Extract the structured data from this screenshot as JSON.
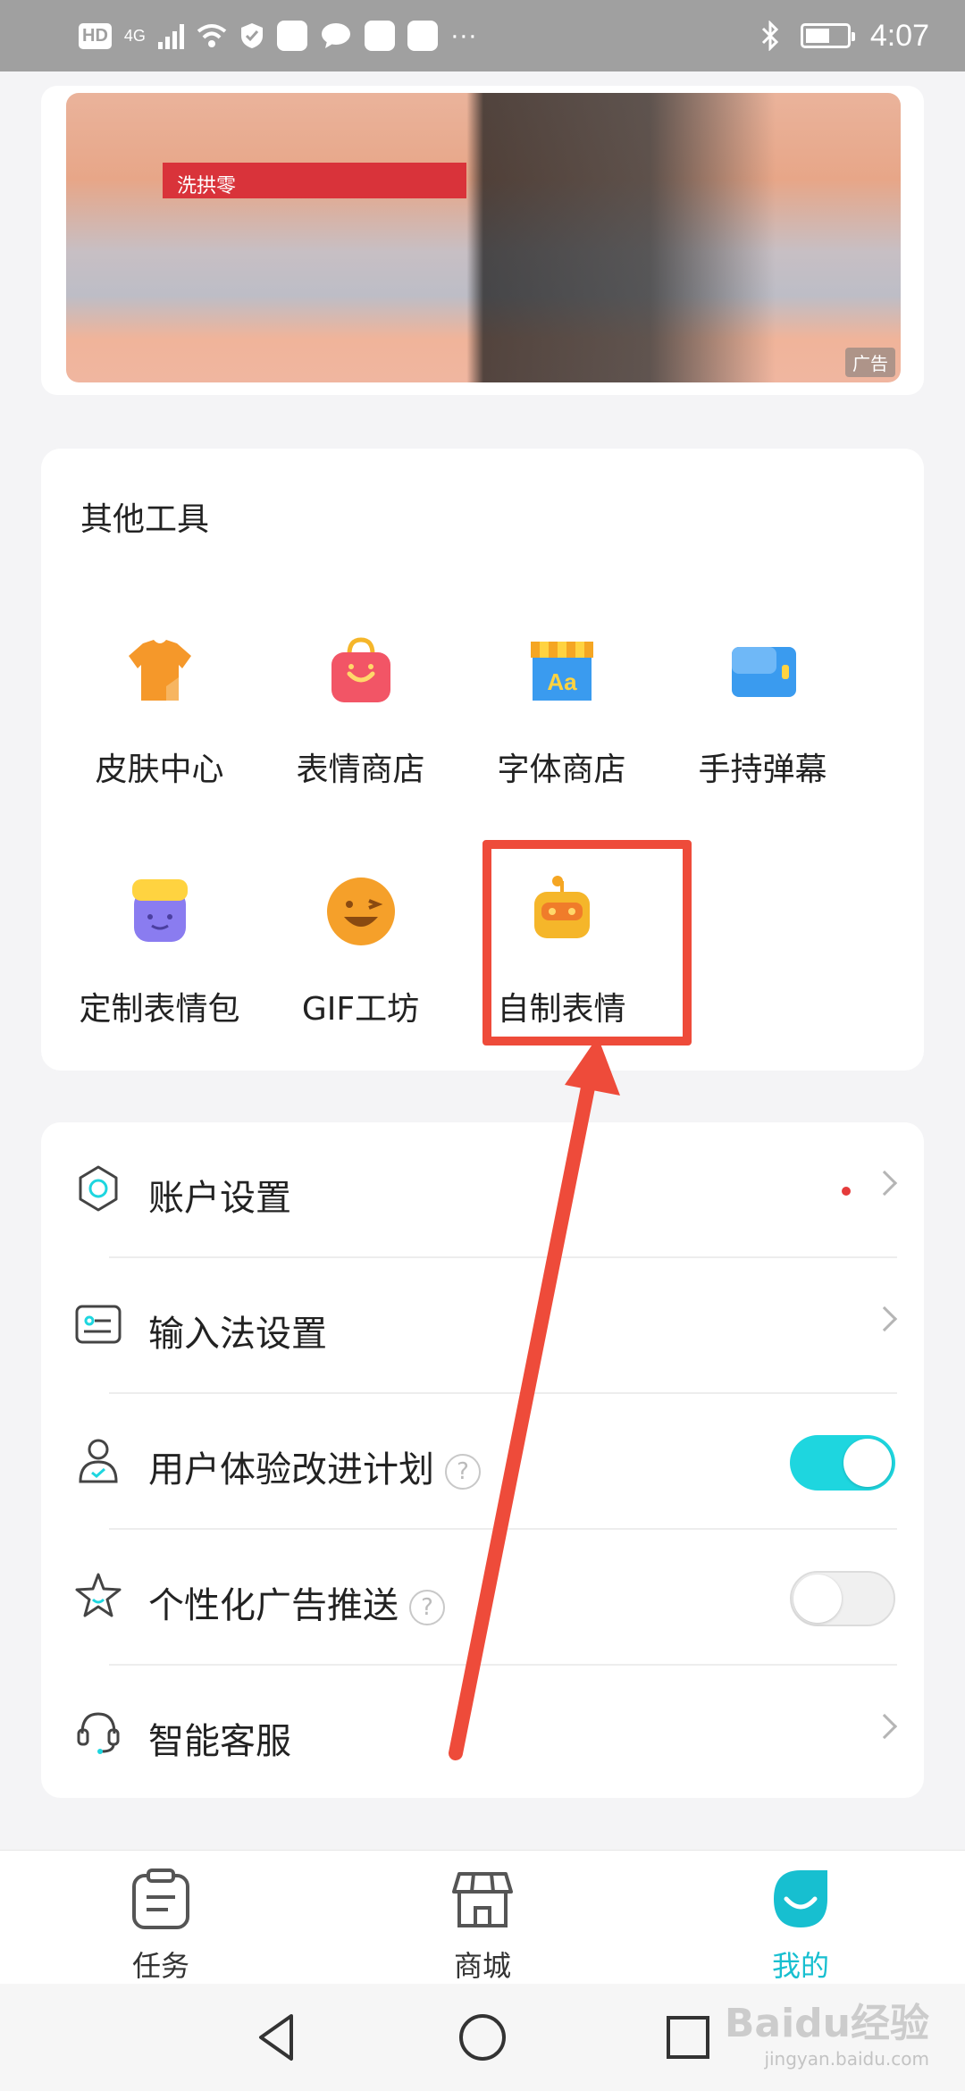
{
  "status_bar": {
    "network": "HD",
    "signal": "4G",
    "time": "4:07",
    "more": "···"
  },
  "ad": {
    "blurred_text": "洗拱零",
    "tag": "广告"
  },
  "tools": {
    "title": "其他工具",
    "items": [
      {
        "label": "皮肤中心",
        "icon": "shirt-icon",
        "color": "#f5982a"
      },
      {
        "label": "表情商店",
        "icon": "shopping-bag-icon",
        "color": "#f25566"
      },
      {
        "label": "字体商店",
        "icon": "font-store-icon",
        "color": "#3a9bef"
      },
      {
        "label": "手持弹幕",
        "icon": "handheld-barrage-icon",
        "color": "#3a9bef"
      },
      {
        "label": "定制表情包",
        "icon": "custom-sticker-icon",
        "color": "#8a7cf0"
      },
      {
        "label": "GIF工坊",
        "icon": "gif-workshop-icon",
        "color": "#f5a02a"
      },
      {
        "label": "自制表情",
        "icon": "robot-icon",
        "color": "#f5b62a"
      }
    ]
  },
  "settings": {
    "rows": [
      {
        "label": "账户设置",
        "icon": "account-settings-icon",
        "control": "chevron",
        "has_dot": true
      },
      {
        "label": "输入法设置",
        "icon": "keyboard-settings-icon",
        "control": "chevron"
      },
      {
        "label": "用户体验改进计划",
        "icon": "user-experience-icon",
        "control": "toggle",
        "enabled": true,
        "help": "?"
      },
      {
        "label": "个性化广告推送",
        "icon": "star-face-icon",
        "control": "toggle",
        "enabled": false,
        "help": "?"
      },
      {
        "label": "智能客服",
        "icon": "headset-icon",
        "control": "chevron"
      }
    ]
  },
  "bottom_nav": {
    "items": [
      {
        "label": "任务",
        "icon": "clipboard-icon"
      },
      {
        "label": "商城",
        "icon": "store-icon"
      },
      {
        "label": "我的",
        "icon": "profile-drop-icon",
        "active": true
      }
    ]
  },
  "watermark": {
    "brand": "Baidu经验",
    "url": "jingyan.baidu.com"
  },
  "colors": {
    "accent": "#17bfd0",
    "highlight": "#ee4b3a",
    "toggle_on": "#1ed6df"
  }
}
